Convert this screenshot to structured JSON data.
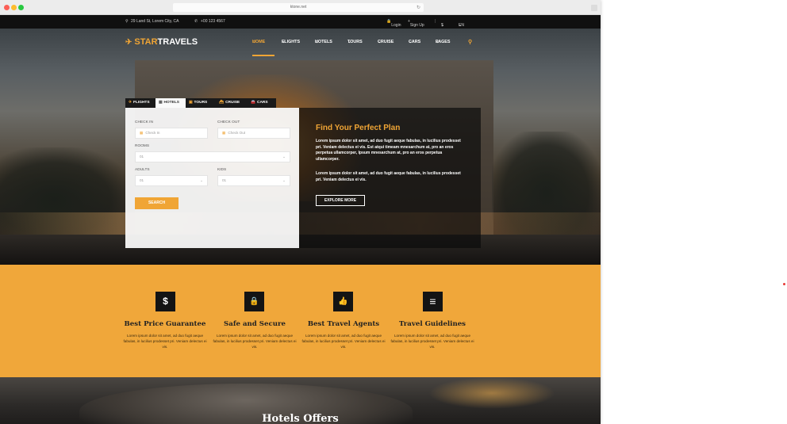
{
  "browser": {
    "url": "ktone.net",
    "reload_icon": "reload-icon"
  },
  "topbar": {
    "address": "29 Land St, Lorem City, CA",
    "phone": "+00 123 4567",
    "login": "Login",
    "signup": "Sign Up",
    "currency": "$",
    "language": "EN"
  },
  "header": {
    "logo_star": "STAR",
    "logo_travels": "TRAVELS",
    "nav": [
      "HOME",
      "FLIGHTS",
      "HOTELS",
      "TOURS",
      "CRUISE",
      "CARS",
      "PAGES"
    ],
    "chevron": "⌄",
    "search_icon": "search-icon"
  },
  "search_tabs": [
    "FLIGHTS",
    "HOTELS",
    "TOURS",
    "CRUISE",
    "CARS"
  ],
  "search_form": {
    "checkin_label": "CHECK IN",
    "checkin_placeholder": "Check In",
    "checkout_label": "CHECK OUT",
    "checkout_placeholder": "Check Out",
    "rooms_label": "ROOMS",
    "rooms_value": "01",
    "adults_label": "ADULTS",
    "adults_value": "01",
    "kids_label": "KIDS",
    "kids_value": "01",
    "search_button": "SEARCH"
  },
  "plan": {
    "title": "Find Your Perfect Plan",
    "para1": "Lorem ipsum dolor sit amet, ad duo fugit aeque fabulas, in lucilius prodesset pri. Veniam delectus ei vis. Est atqui timeam mnesarchum at, pro an eros perpetua ullamcorper, Ipsum mnesarchum at, pro an eros perpetua ullamcorper.",
    "para2": "Lorem ipsum dolor sit amet, ad duo fugit aeque fabulas, in lucilius prodesset pri. Veniam delectus ei vis.",
    "button": "EXPLORE MORE"
  },
  "features": [
    {
      "icon": "$",
      "title": "Best Price Guarantee",
      "desc": "Lorem ipsum dolor sit amet, ad duo fugit aeque fabulas, in lucilius prodesset pri. Veniam delectus ei vis."
    },
    {
      "icon": "🔒",
      "title": "Safe and Secure",
      "desc": "Lorem ipsum dolor sit amet, ad duo fugit aeque fabulas, in lucilius prodesset pri. Veniam delectus ei vis."
    },
    {
      "icon": "👍",
      "title": "Best Travel Agents",
      "desc": "Lorem ipsum dolor sit amet, ad duo fugit aeque fabulas, in lucilius prodesset pri. Veniam delectus ei vis."
    },
    {
      "icon": "≡",
      "title": "Travel Guidelines",
      "desc": "Lorem ipsum dolor sit amet, ad duo fugit aeque fabulas, in lucilius prodesset pri. Veniam delectus ei vis."
    }
  ],
  "offers_title": "Hotels Offers",
  "colors": {
    "accent": "#f0a535",
    "dark": "#141414",
    "band": "#f0a73a"
  }
}
